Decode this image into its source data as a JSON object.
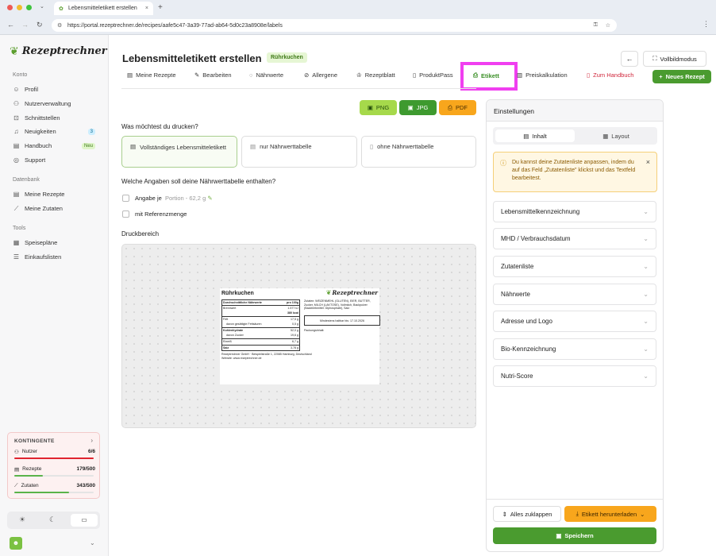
{
  "browser": {
    "tab_title": "Lebensmitteletikett erstellen",
    "url": "https://portal.rezeptrechner.de/recipes/aafe5c47-3a39-77ad-ab64-5d0c23a8908e/labels"
  },
  "brand": {
    "name": "Rezeptrechner",
    "accent": "#5c9e2f"
  },
  "sidebar": {
    "konto_title": "Konto",
    "konto": [
      {
        "label": "Profil",
        "icon": "user-icon"
      },
      {
        "label": "Nutzerverwaltung",
        "icon": "users-icon"
      },
      {
        "label": "Schnittstellen",
        "icon": "plug-icon"
      },
      {
        "label": "Neuigkeiten",
        "icon": "bell-icon",
        "badge": "3"
      },
      {
        "label": "Handbuch",
        "icon": "book-icon",
        "badge": "Neu"
      },
      {
        "label": "Support",
        "icon": "support-icon"
      }
    ],
    "datenbank_title": "Datenbank",
    "datenbank": [
      {
        "label": "Meine Rezepte",
        "icon": "book-icon"
      },
      {
        "label": "Meine Zutaten",
        "icon": "carrot-icon"
      }
    ],
    "tools_title": "Tools",
    "tools": [
      {
        "label": "Speisepläne",
        "icon": "calendar-icon"
      },
      {
        "label": "Einkaufslisten",
        "icon": "list-icon"
      }
    ],
    "kontingente": {
      "title": "KONTINGENTE",
      "rows": [
        {
          "label": "Nutzer",
          "value": "6/6",
          "fill": 1.0,
          "color": "#e0242f"
        },
        {
          "label": "Rezepte",
          "value": "179/500",
          "fill": 0.36,
          "color": "#5ab34a"
        },
        {
          "label": "Zutaten",
          "value": "343/500",
          "fill": 0.69,
          "color": "#5ab34a"
        }
      ]
    }
  },
  "header": {
    "title": "Lebensmitteletikett erstellen",
    "tag": "Rührkuchen",
    "fullscreen": "Vollbildmodus"
  },
  "nav": [
    {
      "label": "Meine Rezepte",
      "icon": "book-icon"
    },
    {
      "label": "Bearbeiten",
      "icon": "pencil-icon"
    },
    {
      "label": "Nährwerte",
      "icon": "apple-icon"
    },
    {
      "label": "Allergene",
      "icon": "wheat-off-icon"
    },
    {
      "label": "Rezeptblatt",
      "icon": "chef-icon"
    },
    {
      "label": "ProduktPass",
      "icon": "doc-icon"
    },
    {
      "label": "Etikett",
      "icon": "printer-icon",
      "active": true
    },
    {
      "label": "Preiskalkulation",
      "icon": "calc-icon"
    }
  ],
  "handbuch": "Zum Handbuch",
  "new_recipe": "Neues Rezept",
  "exports": {
    "png": "PNG",
    "jpg": "JPG",
    "pdf": "PDF"
  },
  "print_question": "Was möchtest du drucken?",
  "print_options": [
    {
      "label": "Vollständiges Lebensmitteletikett",
      "selected": true
    },
    {
      "label": "nur Nährwerttabelle"
    },
    {
      "label": "ohne Nährwerttabelle"
    }
  ],
  "nutri_question": "Welche Angaben soll deine Nährwerttabelle enthalten?",
  "checkbox1": {
    "label": "Angabe je",
    "hint": "Portion - 62,2 g"
  },
  "checkbox2": {
    "label": "mit Referenzmenge"
  },
  "druckbereich": "Druckbereich",
  "label_preview": {
    "title": "Rührkuchen",
    "table_head": [
      "Durchschnittliche Nährwerte",
      "pro 100g"
    ],
    "rows": [
      [
        "Brennwert",
        "1.577 kJ"
      ],
      [
        "",
        "380 kcal"
      ],
      [
        "Fett",
        "17,5 g"
      ],
      [
        "davon gesättigte Fettsäuren",
        "0,5 g"
      ],
      [
        "Kohlenhydrate",
        "52,0 g"
      ],
      [
        "davon Zucker",
        "19,6 g"
      ],
      [
        "Eiweiß",
        "6,7 g"
      ],
      [
        "Salz",
        "3,78 g"
      ]
    ],
    "ingredients": "Zutaten: WEIZENMEHL (GLUTEN), EIER, BUTTER, Zucker, MILCH (LAKTOSE), Vollmilch, Backpulver (Backtriebmittel: Diphosphate), Salz",
    "mhd": "Mindestens haltbar bis: 17.10.2026",
    "lot": "Packungsinhalt:",
    "footer": "Rezeptrechner GmbH · Beispielstraße 1, 22085 Hamburg, Deutschland",
    "website": "Website: www.rezeptrechner.de"
  },
  "settings": {
    "title": "Einstellungen",
    "tabs": [
      "Inhalt",
      "Layout"
    ],
    "info": "Du kannst deine Zutatenliste anpassen, indem du auf das Feld „Zutatenliste\" klickst und das Textfeld bearbeitest.",
    "sections": [
      "Lebensmittelkennzeichnung",
      "MHD / Verbrauchsdatum",
      "Zutatenliste",
      "Nährwerte",
      "Adresse und Logo",
      "Bio-Kennzeichnung",
      "Nutri-Score"
    ],
    "collapse": "Alles zuklappen",
    "download": "Etikett herunterladen",
    "save": "Speichern"
  }
}
